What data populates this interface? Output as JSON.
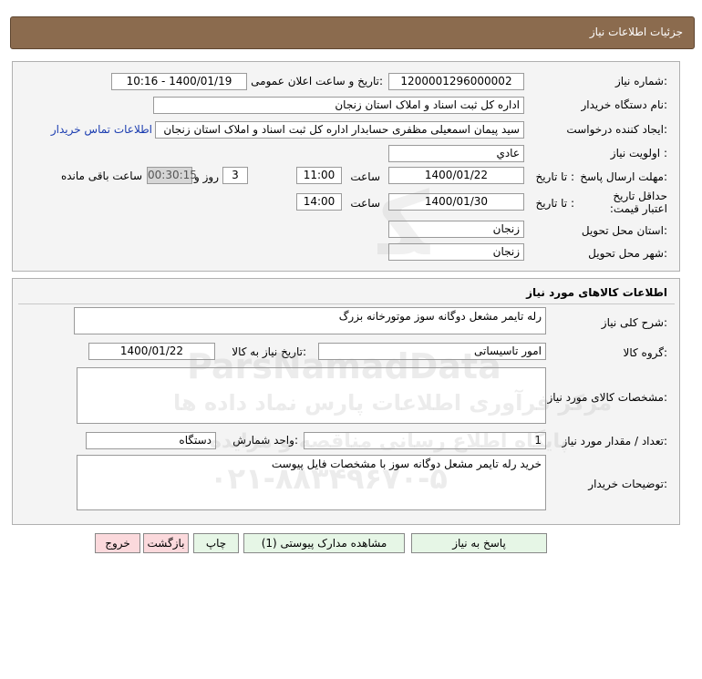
{
  "header": {
    "title": "جزئیات اطلاعات نیاز"
  },
  "details": {
    "need_number_label": "شماره نیاز:",
    "need_number": "1200001296000002",
    "announce_label": "تاریخ و ساعت اعلان عمومی:",
    "announce_value": "1400/01/19 - 10:16",
    "buyer_org_label": "نام دستگاه خریدار:",
    "buyer_org": "اداره کل ثبت اسناد و املاک استان زنجان",
    "requester_label": "ایجاد کننده درخواست:",
    "requester": "سید پیمان اسمعیلی مظفری حسابدار  اداره کل ثبت اسناد و املاک استان زنجان",
    "contact_link": "اطلاعات تماس خریدار",
    "priority_label": "اولویت نیاز :",
    "priority": "عادي",
    "deadline_label": "مهلت ارسال پاسخ:",
    "to_date_label": "تا تاریخ :",
    "deadline_date": "1400/01/22",
    "time_label": "ساعت",
    "deadline_time": "11:00",
    "days_value": "3",
    "days_label": "روز و",
    "remaining_time": "00:30:15",
    "remaining_label": "ساعت باقی مانده",
    "price_validity_label": "حداقل تاریخ اعتبار قیمت:",
    "price_to_date_label": "تا تاریخ :",
    "price_validity_date": "1400/01/30",
    "price_time_label": "ساعت",
    "price_validity_time": "14:00",
    "province_label": "استان محل تحویل:",
    "province": "زنجان",
    "city_label": "شهر محل تحویل:",
    "city": "زنجان"
  },
  "goods": {
    "section_title": "اطلاعات کالاهای مورد نیاز",
    "general_desc_label": "شرح کلی نیاز:",
    "general_desc": "رله تایمر مشعل دوگانه سوز موتورخانه بزرگ",
    "group_label": "گروه کالا:",
    "group": "امور تاسیساتی",
    "need_date_label": "تاریخ نیاز به کالا:",
    "need_date": "1400/01/22",
    "spec_label": "مشخصات کالای مورد نیاز:",
    "spec": "",
    "qty_label": "تعداد / مقدار مورد نیاز:",
    "qty": "1",
    "unit_label": "واحد شمارش:",
    "unit": "دستگاه",
    "buyer_notes_label": "توضیحات خریدار:",
    "buyer_notes": "خرید رله تایمر مشعل دوگانه سوز با مشخصات فایل پیوست"
  },
  "watermark": {
    "line1": "ParsNamadData",
    "line2": "مرکز فرآوری اطلاعات پارس نماد داده ها",
    "line3": "پایگاه اطلاع رسانی مناقصه و مزایده",
    "line4": "۰۲۱-۸۸۳۴۹۶۷۰-۵"
  },
  "buttons": {
    "reply": "پاسخ به نیاز",
    "view_docs": "مشاهده مدارک پیوستی (1)",
    "print": "چاپ",
    "back": "بازگشت",
    "exit": "خروج"
  }
}
